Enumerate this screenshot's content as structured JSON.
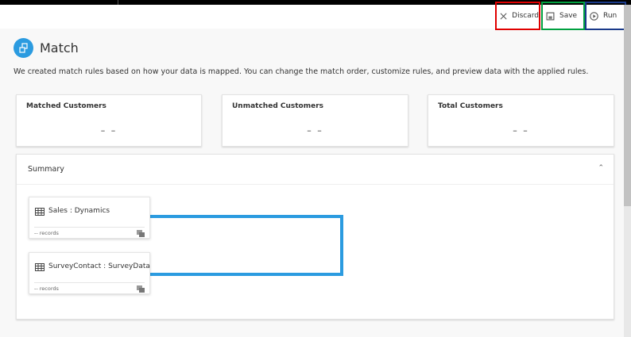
{
  "toolbar": {
    "discard": "Discard",
    "save": "Save",
    "run": "Run"
  },
  "header": {
    "title": "Match",
    "description": "We created match rules based on how your data is mapped. You can change the match order, customize rules, and preview data with the applied rules."
  },
  "cards": [
    {
      "label": "Matched Customers",
      "value": "– –"
    },
    {
      "label": "Unmatched Customers",
      "value": "– –"
    },
    {
      "label": "Total Customers",
      "value": "– –"
    }
  ],
  "summary": {
    "title": "Summary",
    "entities": [
      {
        "name": "Sales : Dynamics",
        "records": "-- records"
      },
      {
        "name": "SurveyContact : SurveyData",
        "records": "-- records"
      }
    ]
  },
  "colors": {
    "accent": "#2b9be0",
    "discard_outline": "#e00000",
    "save_outline": "#00a040",
    "run_outline": "#1a3a8a"
  }
}
